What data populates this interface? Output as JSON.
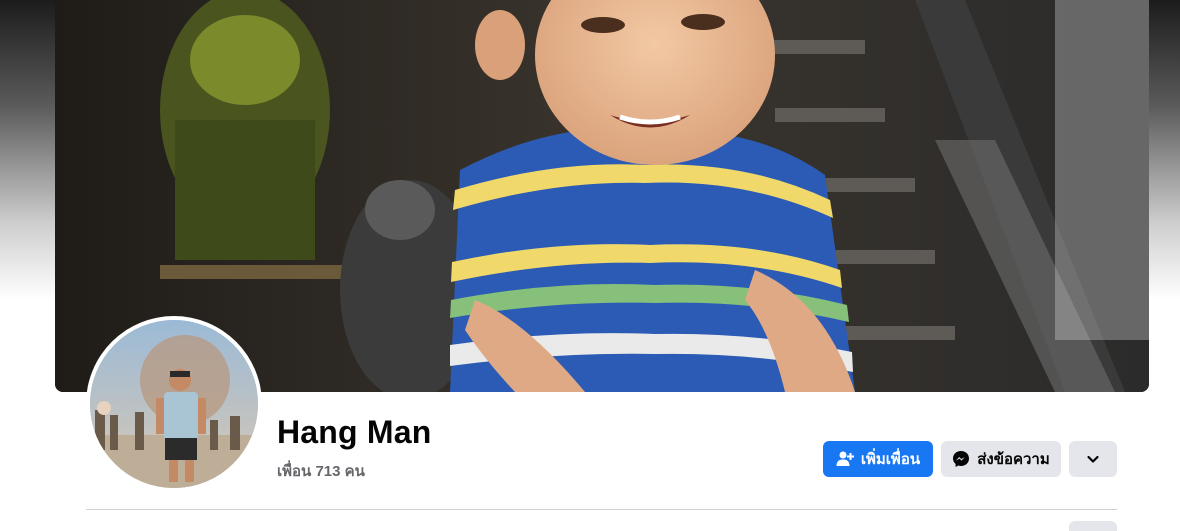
{
  "profile": {
    "name": "Hang Man",
    "friends_count_label": "เพื่อน 713 คน"
  },
  "actions": {
    "add_friend_label": "เพิ่มเพื่อน",
    "message_label": "ส่งข้อความ",
    "more_icon": "chevron-down-icon",
    "add_friend_icon": "add-person-icon",
    "message_icon": "messenger-icon"
  },
  "colors": {
    "primary": "#1877f2",
    "secondary_button": "#e4e6eb",
    "name_text": "#050505",
    "muted_text": "#65676b",
    "divider": "#ced0d4"
  }
}
